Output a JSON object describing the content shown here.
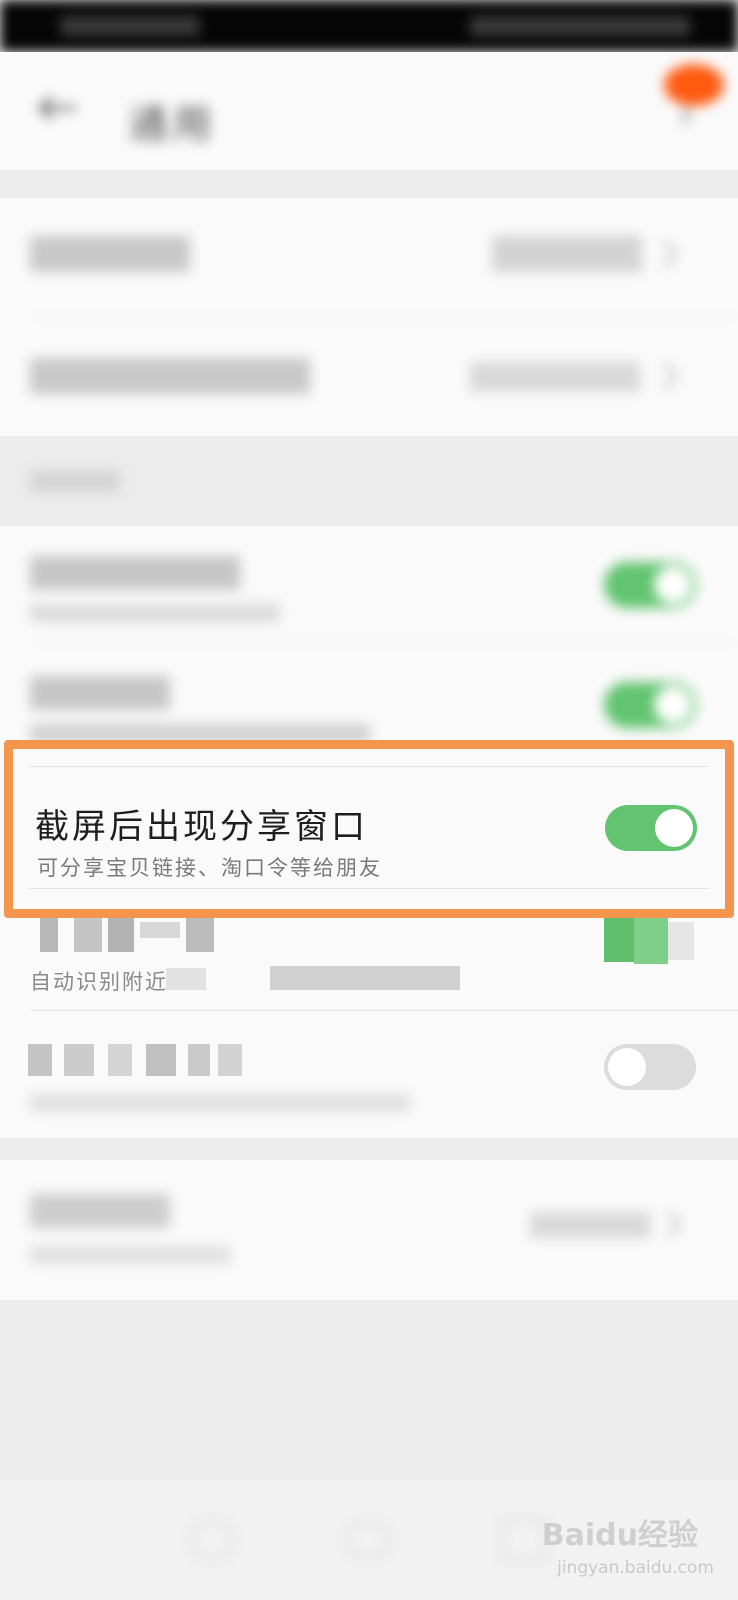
{
  "header": {
    "title": "通用"
  },
  "highlighted_setting": {
    "title": "截屏后出现分享窗口",
    "subtitle": "可分享宝贝链接、淘口令等给朋友",
    "toggle_state": "on"
  },
  "row_pixelated": {
    "subtitle_start": "自动识别附近"
  },
  "watermark": {
    "brand": "Baidu经验",
    "url": "jingyan.baidu.com"
  },
  "colors": {
    "toggle_on": "#62c370",
    "highlight_border": "#f4954d",
    "notification_dot": "#ff5a10"
  }
}
